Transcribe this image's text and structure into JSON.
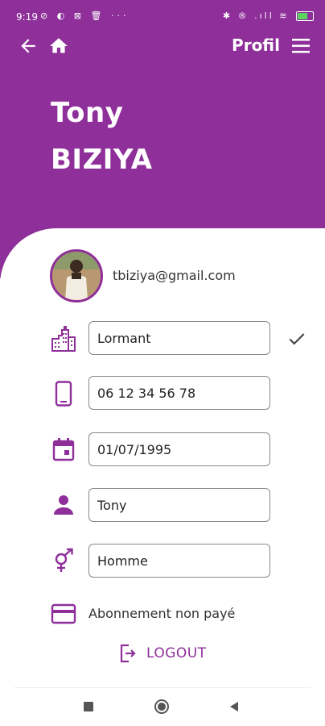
{
  "status": {
    "time": "9:19",
    "left_icons": "⊘ ◐ ⊠ 🗑 ···",
    "right_icons": "✱ ® .ıll ≋",
    "battery_level": 0.6,
    "battery_text": "61"
  },
  "topbar": {
    "back_icon": "arrow-left-icon",
    "home_icon": "home-icon",
    "title": "Profil",
    "menu_icon": "hamburger-menu-icon"
  },
  "profile": {
    "first_name": "Tony",
    "last_name": "BIZIYA",
    "email": "tbiziya@gmail.com"
  },
  "fields": {
    "city": "Lormant",
    "phone": "06 12 34 56 78",
    "birthdate": "01/07/1995",
    "firstname": "Tony",
    "gender": "Homme"
  },
  "subscription": "Abonnement non payé",
  "logout_label": "LOGOUT",
  "colors": {
    "accent": "#8e2f9a",
    "header_bg": "#8e2f9a",
    "text": "#222222"
  }
}
